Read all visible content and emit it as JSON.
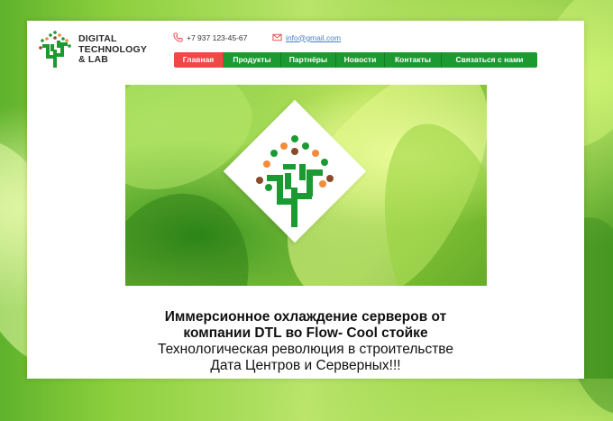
{
  "brand": {
    "line1": "DIGITAL",
    "line2": "TECHNOLOGY",
    "line3": "& LAB"
  },
  "contacts": {
    "phone_icon": "phone-icon",
    "phone": "+7 937 123-45-67",
    "email_icon": "mail-icon",
    "email": "info@gmail.com"
  },
  "nav": {
    "items": [
      {
        "label": "Главная",
        "active": true
      },
      {
        "label": "Продукты",
        "active": false
      },
      {
        "label": "Партнёры",
        "active": false
      },
      {
        "label": "Новости",
        "active": false
      },
      {
        "label": "Контакты",
        "active": false
      },
      {
        "label": "Связаться с нами",
        "active": false
      }
    ]
  },
  "hero": {
    "emblem": "tree-logo-icon"
  },
  "headline": {
    "bold_line1": "Иммерсионное охлаждение серверов от",
    "bold_line2": "компании DTL во Flow- Cool стойке",
    "line3": "Технологическая революция в строительстве",
    "line4": "Дата Центров и Серверных!!!"
  },
  "colors": {
    "brand_green": "#1c9a32",
    "active_red": "#f04747",
    "dot_orange": "#f28c3a",
    "dot_brown": "#8a4b2a"
  }
}
